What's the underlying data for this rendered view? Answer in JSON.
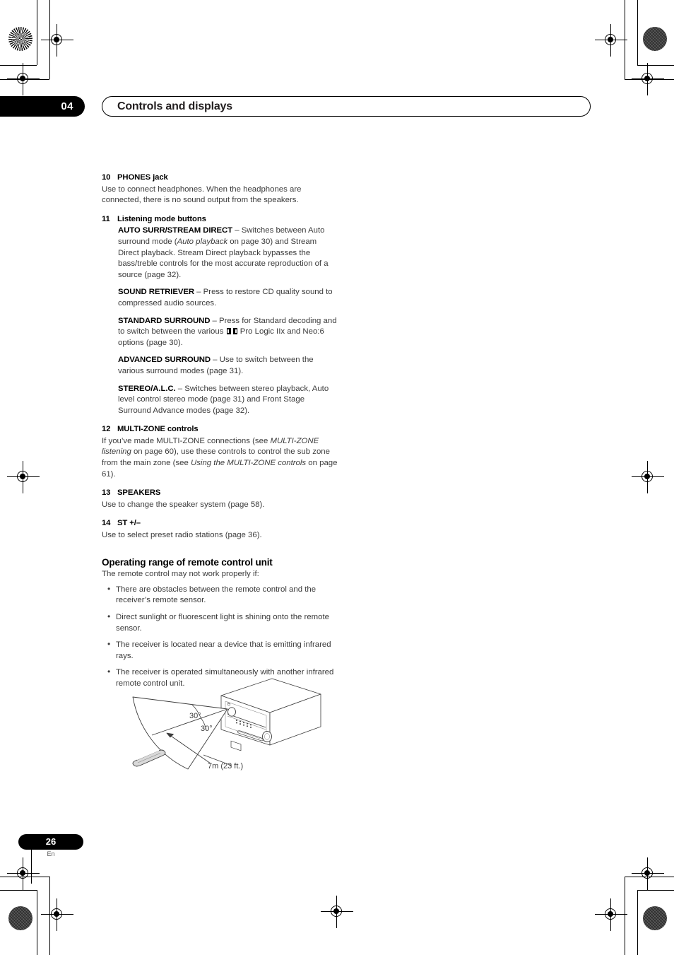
{
  "header": {
    "chapter_number": "04",
    "title": "Controls and displays"
  },
  "items": [
    {
      "num": "10",
      "head": "PHONES jack",
      "body": "Use to connect headphones. When the headphones are connected, there is no sound output from the speakers."
    },
    {
      "num": "11",
      "head": "Listening mode buttons"
    },
    {
      "num": "12",
      "head": "MULTI-ZONE controls"
    },
    {
      "num": "13",
      "head": "SPEAKERS",
      "body": "Use to change the speaker system (page 58)."
    },
    {
      "num": "14",
      "head": "ST +/–",
      "body": "Use to select preset radio stations (page 36)."
    }
  ],
  "listening_modes": [
    {
      "label": "AUTO SURR/STREAM DIRECT",
      "dash": " – ",
      "text_1": "Switches between Auto surround mode (",
      "italic_1": "Auto playback",
      "text_2": " on page 30) and Stream Direct playback. Stream Direct playback bypasses the bass/treble controls for the most accurate reproduction of a source (page 32)."
    },
    {
      "label": "SOUND RETRIEVER",
      "dash": " – ",
      "text_1": "Press to restore CD quality sound to compressed audio sources."
    },
    {
      "label": "STANDARD SURROUND",
      "dash": " – ",
      "text_1": "Press for Standard decoding and to switch between the various ",
      "has_dolby_icon": true,
      "text_2": " Pro Logic IIx and Neo:6 options (page 30)."
    },
    {
      "label": "ADVANCED SURROUND",
      "dash": " – ",
      "text_1": "Use to switch between the various surround modes (page 31)."
    },
    {
      "label": "STEREO/A.L.C.",
      "dash": " – ",
      "text_1": "Switches between stereo playback, Auto level control stereo mode (page 31) and Front Stage Surround Advance modes (page 32)."
    }
  ],
  "multizone": {
    "text_1": "If you’ve made MULTI-ZONE connections (see ",
    "italic_1": "MULTI-ZONE listening",
    "text_2": " on page 60), use these controls to control the sub zone from the main zone (see ",
    "italic_2": "Using the MULTI-ZONE controls",
    "text_3": " on page 61)."
  },
  "operating_range": {
    "heading": "Operating range of remote control unit",
    "intro": "The remote control may not work properly if:",
    "bullets": [
      "There are obstacles between the remote control and the receiver’s remote sensor.",
      "Direct sunlight or fluorescent light is shining onto the remote sensor.",
      "The receiver is located near a device that is emitting infrared rays.",
      "The receiver is operated simultaneously with another infrared remote control unit."
    ]
  },
  "figure": {
    "angle_upper": "30°",
    "angle_lower": "30°",
    "distance": "7m (23 ft.)"
  },
  "footer": {
    "page_number": "26",
    "language": "En"
  }
}
